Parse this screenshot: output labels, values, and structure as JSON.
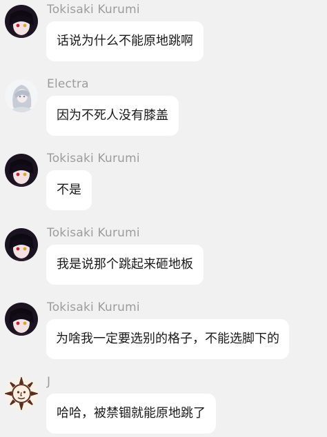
{
  "messages": [
    {
      "sender": "Tokisaki Kurumi",
      "avatar": "kurumi-avatar",
      "text": "话说为什么不能原地跳啊"
    },
    {
      "sender": "Electra",
      "avatar": "electra-avatar",
      "text": "因为不死人没有膝盖"
    },
    {
      "sender": "Tokisaki Kurumi",
      "avatar": "kurumi-avatar",
      "text": "不是"
    },
    {
      "sender": "Tokisaki Kurumi",
      "avatar": "kurumi-avatar",
      "text": "我是说那个跳起来砸地板"
    },
    {
      "sender": "Tokisaki Kurumi",
      "avatar": "kurumi-avatar",
      "text": "为啥我一定要选别的格子，不能选脚下的"
    },
    {
      "sender": "J",
      "avatar": "sun-avatar",
      "text": "哈哈，被禁锢就能原地跳了"
    }
  ],
  "colors": {
    "background": "#f1f1f1",
    "bubble": "#ffffff",
    "sender_text": "#9c9c9c",
    "message_text": "#1a1a1a"
  }
}
